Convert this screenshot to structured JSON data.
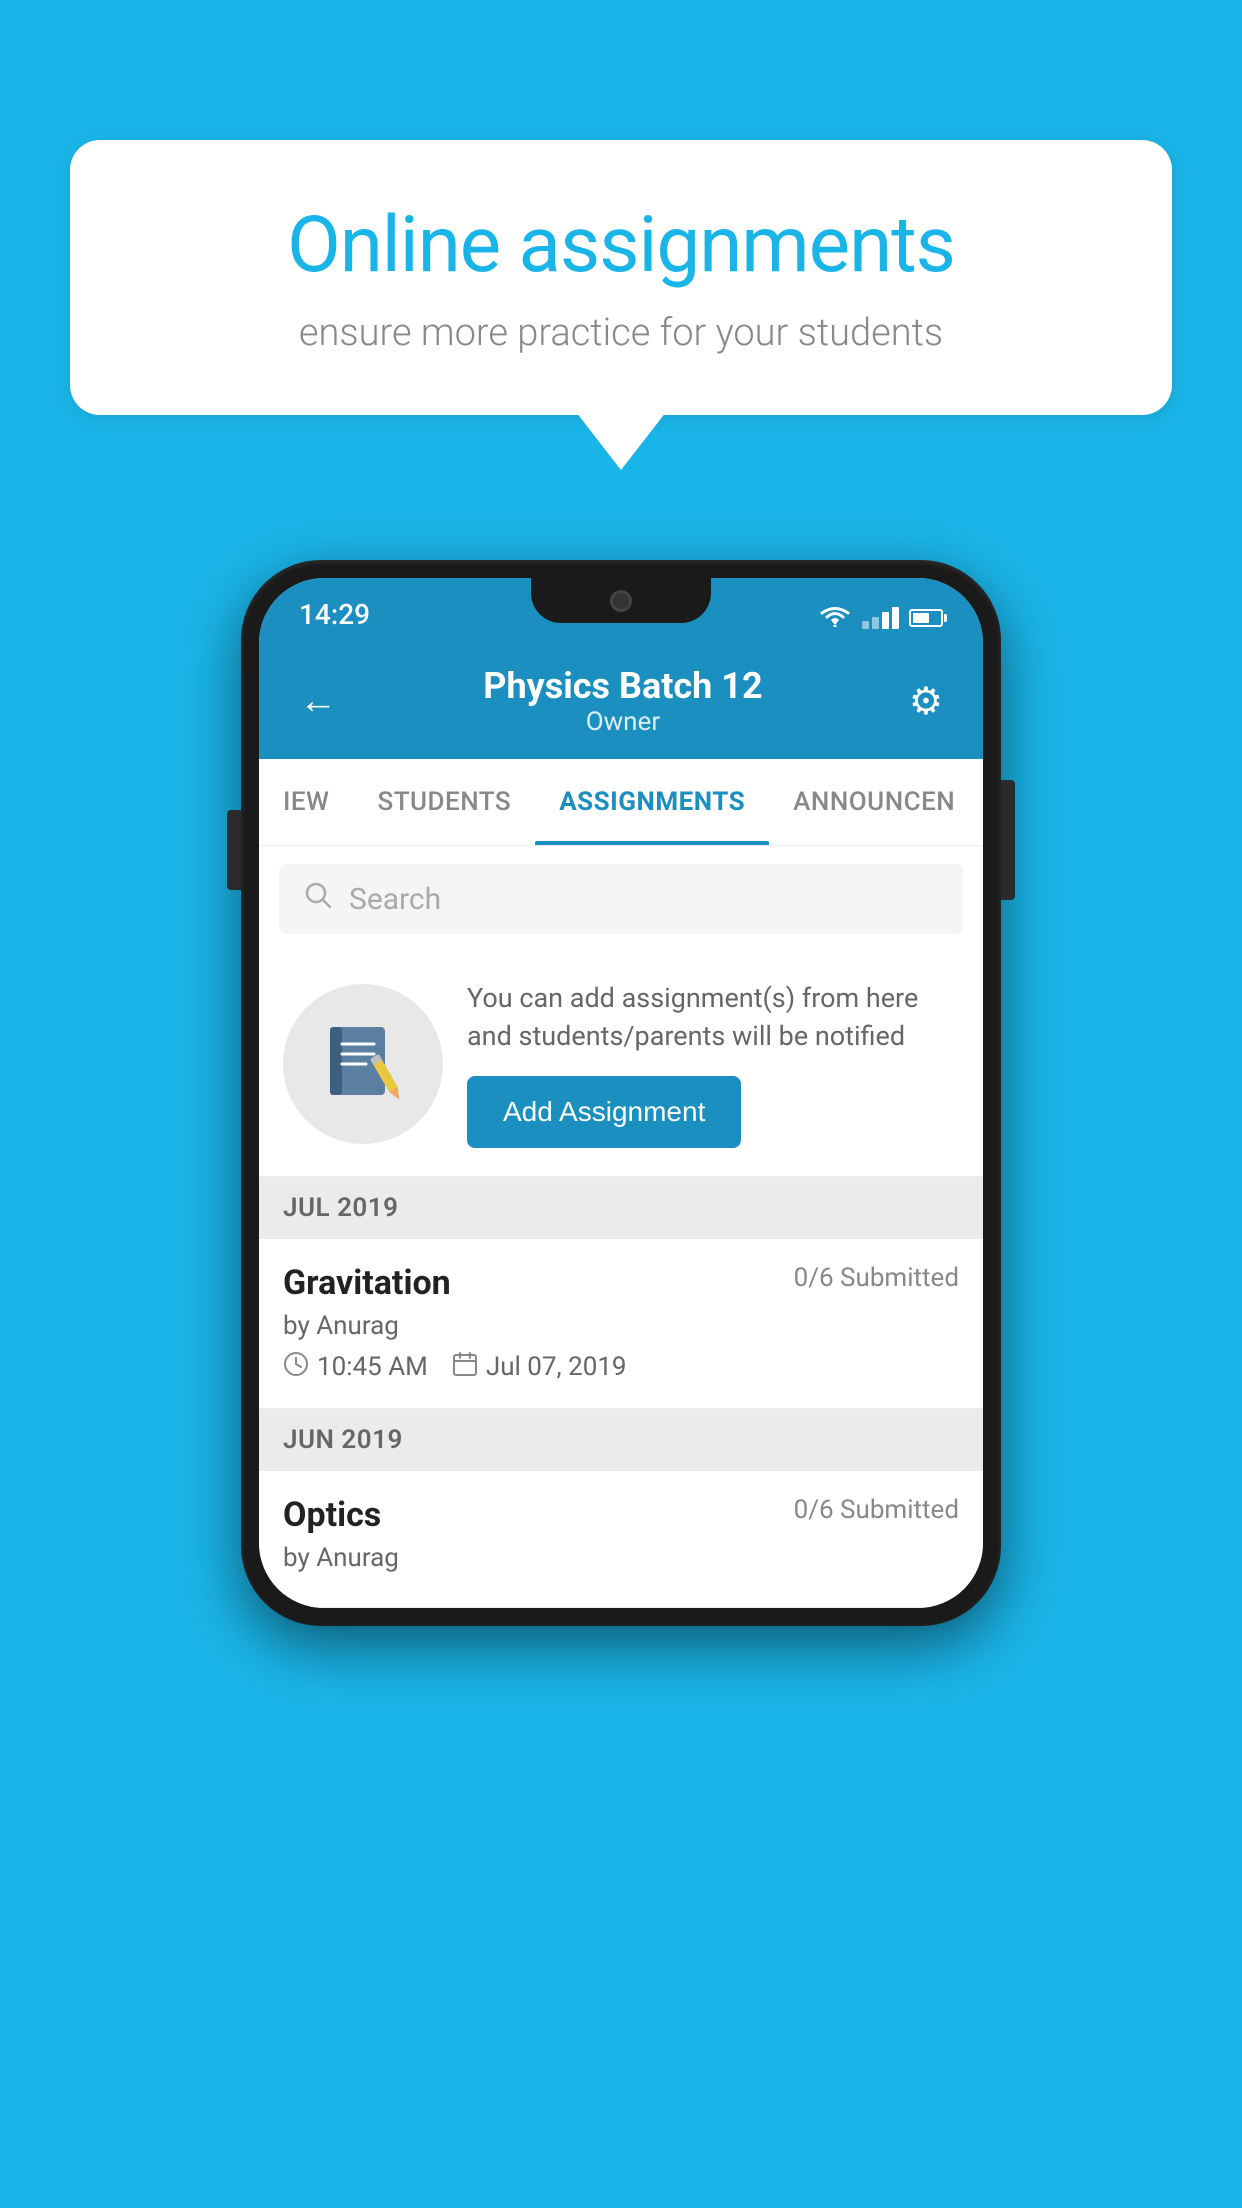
{
  "background_color": "#1ab5e8",
  "speech_bubble": {
    "title": "Online assignments",
    "subtitle": "ensure more practice for your students"
  },
  "status_bar": {
    "time": "14:29"
  },
  "header": {
    "title": "Physics Batch 12",
    "subtitle": "Owner"
  },
  "tabs": [
    {
      "label": "IEW",
      "active": false
    },
    {
      "label": "STUDENTS",
      "active": false
    },
    {
      "label": "ASSIGNMENTS",
      "active": true
    },
    {
      "label": "ANNOUNCEN",
      "active": false
    }
  ],
  "search": {
    "placeholder": "Search"
  },
  "promo": {
    "description": "You can add assignment(s) from here and students/parents will be notified",
    "button_label": "Add Assignment"
  },
  "sections": [
    {
      "header": "JUL 2019",
      "assignments": [
        {
          "name": "Gravitation",
          "status": "0/6 Submitted",
          "by": "by Anurag",
          "time": "10:45 AM",
          "date": "Jul 07, 2019"
        }
      ]
    },
    {
      "header": "JUN 2019",
      "assignments": [
        {
          "name": "Optics",
          "status": "0/6 Submitted",
          "by": "by Anurag",
          "time": "",
          "date": ""
        }
      ]
    }
  ]
}
